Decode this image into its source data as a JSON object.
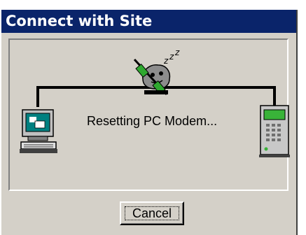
{
  "window": {
    "title": "Connect with Site"
  },
  "status": {
    "message": "Resetting PC Modem..."
  },
  "buttons": {
    "cancel_label": "Cancel"
  },
  "icons": {
    "local": "pc-modem-icon",
    "connection": "sleeping-modem-icon",
    "remote": "site-panel-icon"
  },
  "colors": {
    "titlebar": "#0a246a",
    "face": "#d4d0c8",
    "modem_led": "#2fa82f"
  }
}
